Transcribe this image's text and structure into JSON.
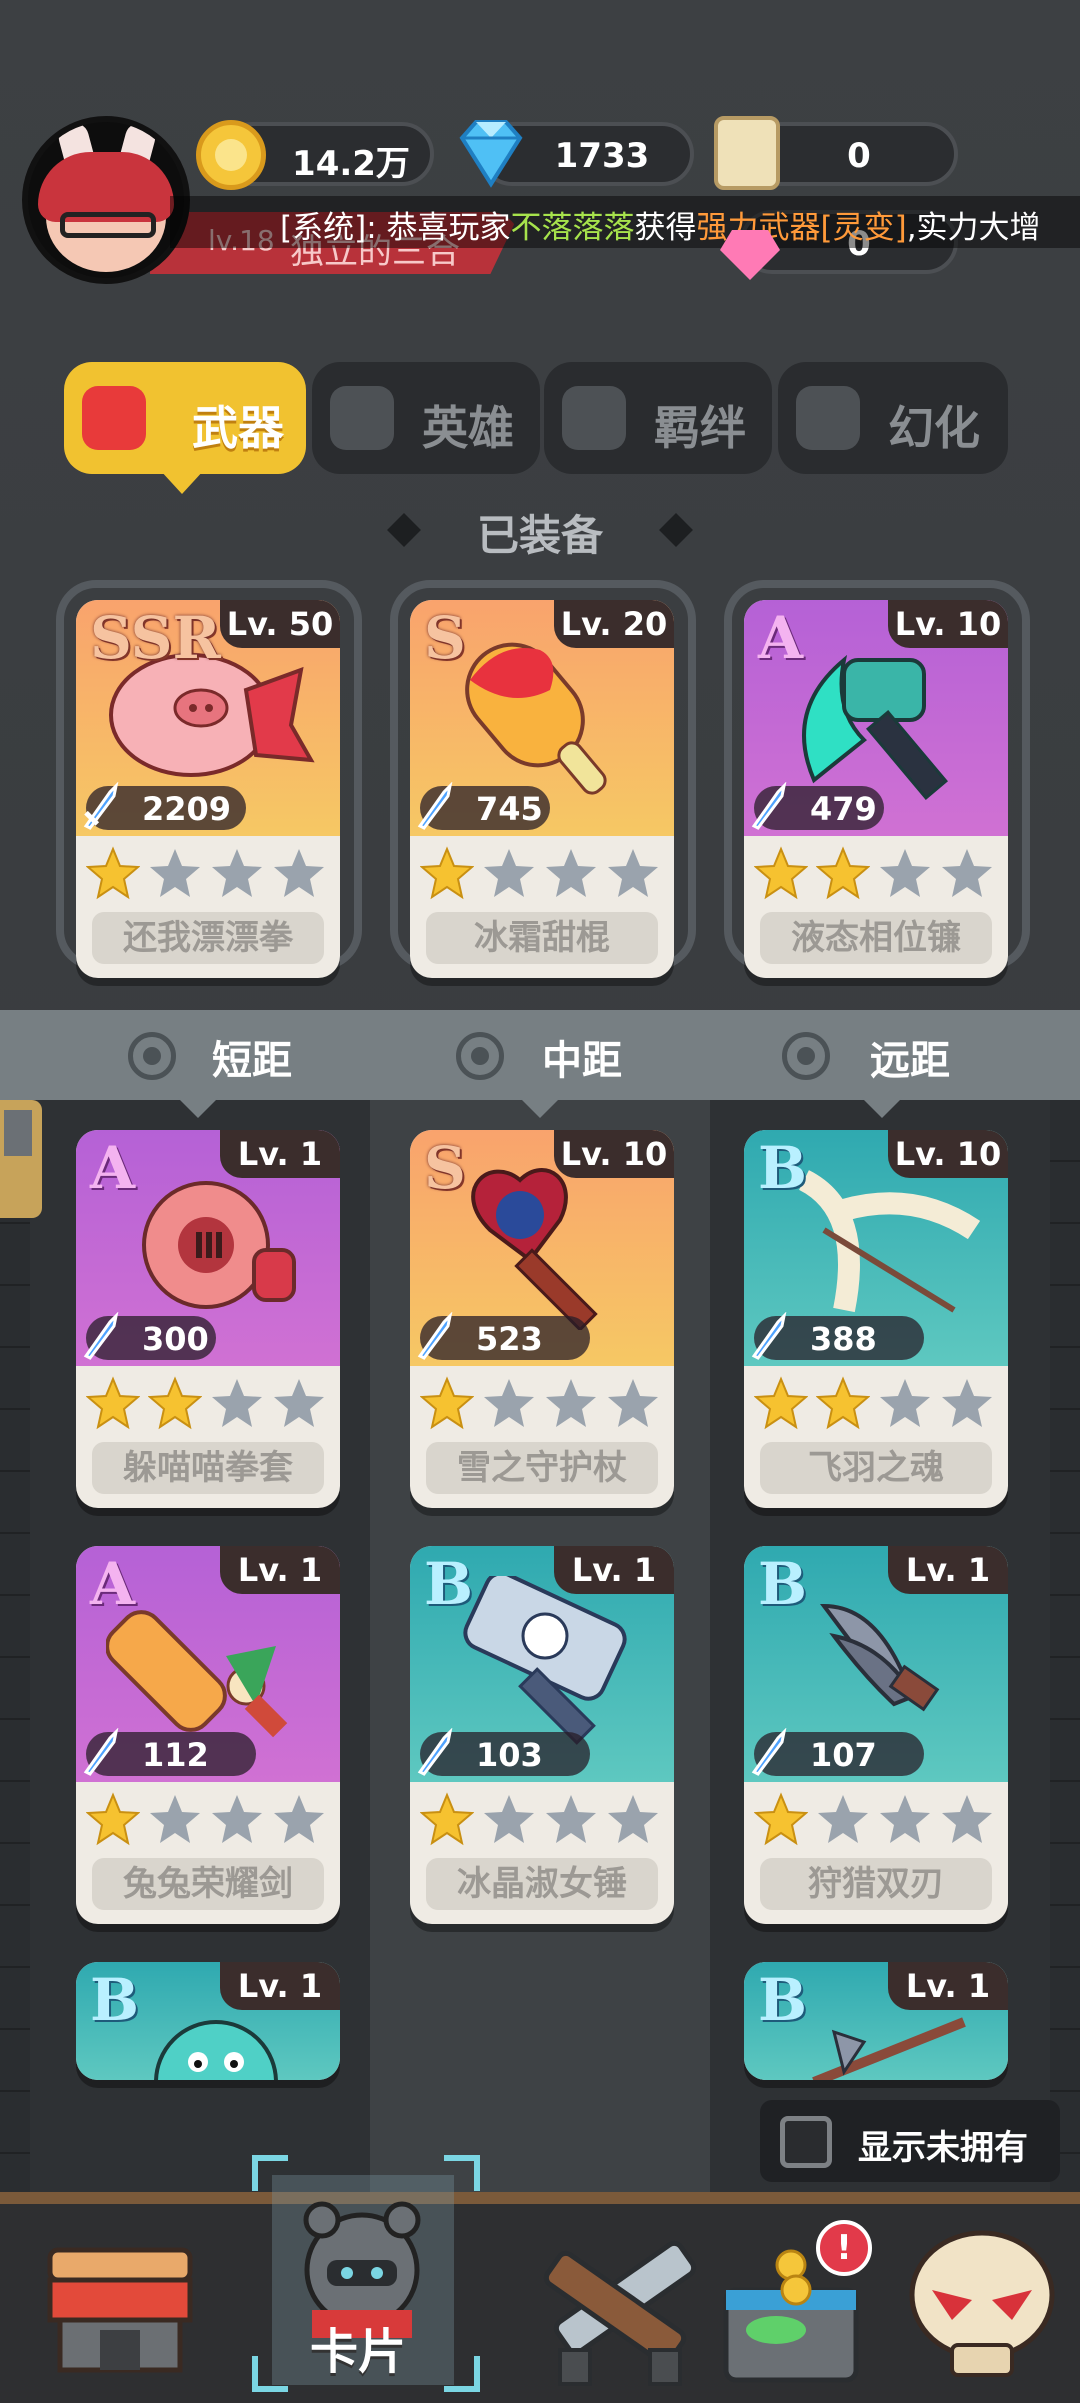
{
  "player": {
    "level_label": "lv.18",
    "title": "独立的三合"
  },
  "currencies": {
    "gold": "14.2万",
    "diamonds": "1733",
    "scrolls": "0",
    "gems": "0"
  },
  "ticker": {
    "prefix": "[系统]: 恭喜玩家",
    "player": "不落落落",
    "mid": "获得",
    "item": "强力武器[灵变]",
    "suffix": ",实力大增"
  },
  "tabs": [
    {
      "label": "武器",
      "active": true
    },
    {
      "label": "英雄"
    },
    {
      "label": "羁绊"
    },
    {
      "label": "幻化"
    }
  ],
  "equipped_title": "已装备",
  "equipped": [
    {
      "rank": "SSR",
      "level": "Lv. 50",
      "power": "2209",
      "stars": 1,
      "name": "还我漂漂拳"
    },
    {
      "rank": "S",
      "level": "Lv. 20",
      "power": "745",
      "stars": 1,
      "name": "冰霜甜棍"
    },
    {
      "rank": "A",
      "level": "Lv. 10",
      "power": "479",
      "stars": 2,
      "name": "液态相位镰"
    }
  ],
  "ranges": {
    "short": "短距",
    "mid": "中距",
    "long": "远距"
  },
  "inventory": [
    {
      "rank": "A",
      "level": "Lv. 1",
      "power": "300",
      "stars": 2,
      "name": "躲喵喵拳套"
    },
    {
      "rank": "S",
      "level": "Lv. 10",
      "power": "523",
      "stars": 1,
      "name": "雪之守护杖"
    },
    {
      "rank": "B",
      "level": "Lv. 10",
      "power": "388",
      "stars": 2,
      "name": "飞羽之魂"
    },
    {
      "rank": "A",
      "level": "Lv. 1",
      "power": "112",
      "stars": 1,
      "name": "兔兔荣耀剑"
    },
    {
      "rank": "B",
      "level": "Lv. 1",
      "power": "103",
      "stars": 1,
      "name": "冰晶淑女锤"
    },
    {
      "rank": "B",
      "level": "Lv. 1",
      "power": "107",
      "stars": 1,
      "name": "狩猎双刃"
    },
    {
      "rank": "B",
      "level": "Lv. 1"
    },
    {
      "rank": "B",
      "level": "Lv. 1"
    }
  ],
  "show_unowned": "显示未拥有",
  "nav": {
    "cards_label": "卡片",
    "badge": "!"
  },
  "colors": {
    "gold_tab": "#f1c230",
    "star_on": "#f6c230",
    "star_off": "#9aa3ad",
    "accent_red": "#e23a4a"
  }
}
